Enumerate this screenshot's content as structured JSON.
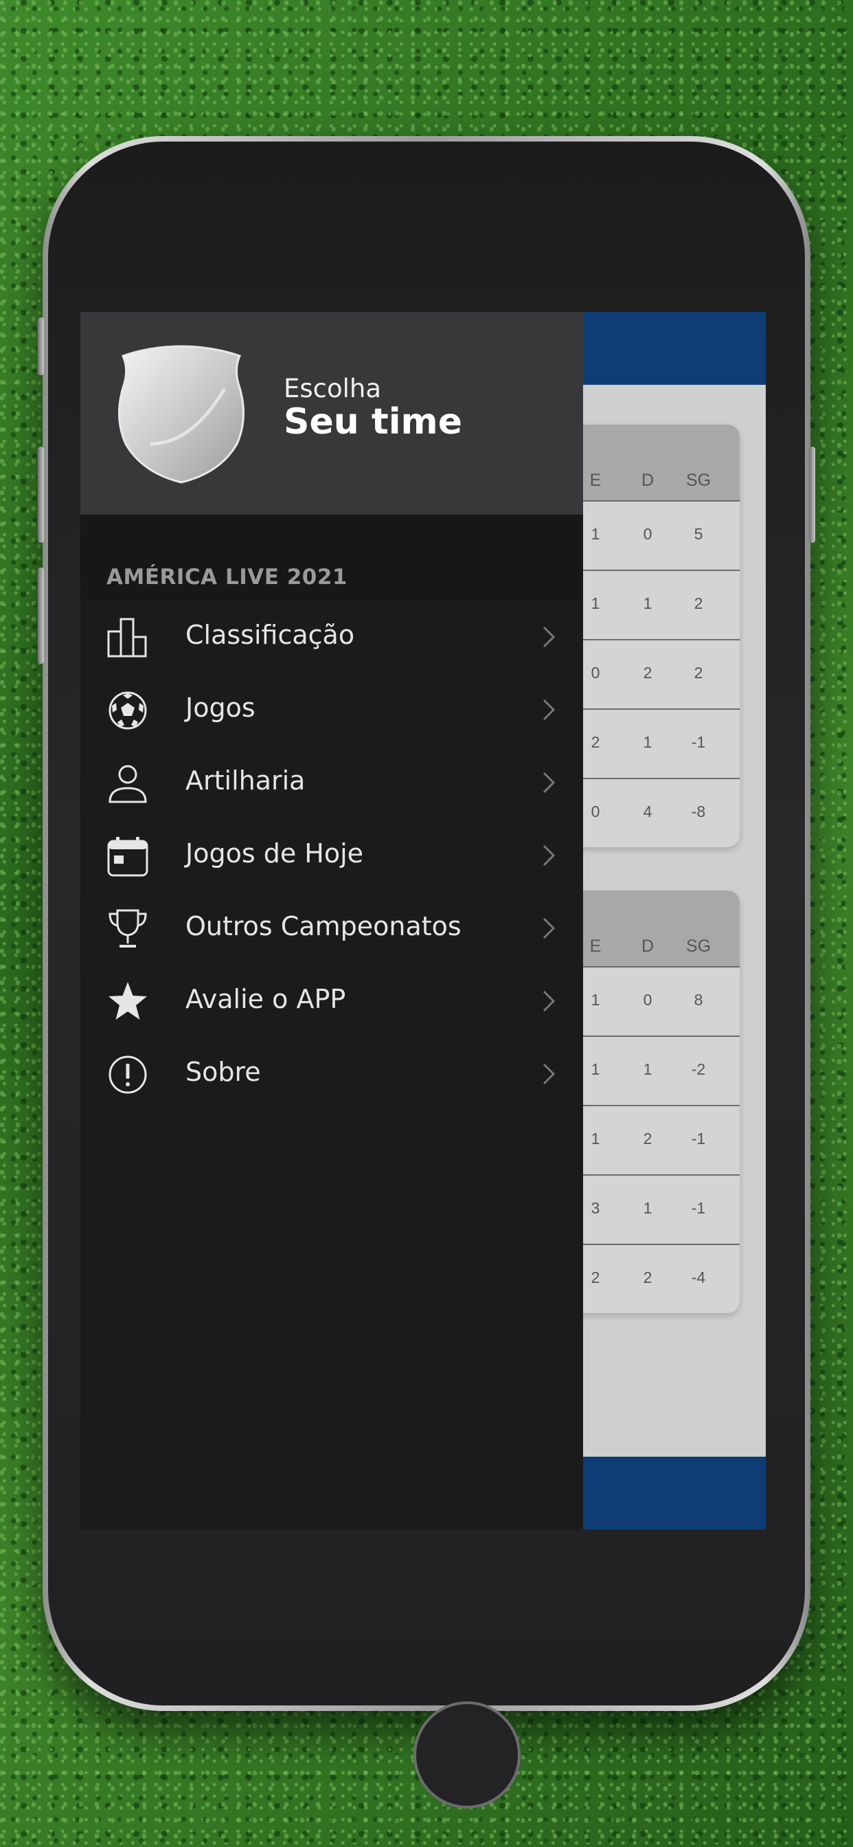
{
  "app": {
    "header": {
      "subtitle": "Escolha",
      "title": "Seu time"
    },
    "section_title": "AMÉRICA LIVE 2021",
    "menu": [
      {
        "label": "Classificação",
        "icon": "bar-chart-icon"
      },
      {
        "label": "Jogos",
        "icon": "soccer-ball-icon"
      },
      {
        "label": "Artilharia",
        "icon": "person-icon"
      },
      {
        "label": "Jogos de Hoje",
        "icon": "calendar-icon"
      },
      {
        "label": "Outros Campeonatos",
        "icon": "trophy-icon"
      },
      {
        "label": "Avalie o APP",
        "icon": "star-icon"
      },
      {
        "label": "Sobre",
        "icon": "info-circle-icon"
      }
    ]
  },
  "tables": [
    {
      "columns": [
        "E",
        "D",
        "SG"
      ],
      "rows": [
        [
          "1",
          "0",
          "5"
        ],
        [
          "1",
          "1",
          "2"
        ],
        [
          "0",
          "2",
          "2"
        ],
        [
          "2",
          "1",
          "-1"
        ],
        [
          "0",
          "4",
          "-8"
        ]
      ]
    },
    {
      "columns": [
        "E",
        "D",
        "SG"
      ],
      "rows": [
        [
          "1",
          "0",
          "8"
        ],
        [
          "1",
          "1",
          "-2"
        ],
        [
          "1",
          "2",
          "-1"
        ],
        [
          "3",
          "1",
          "-1"
        ],
        [
          "2",
          "2",
          "-4"
        ]
      ]
    }
  ],
  "colors": {
    "drawer_bg": "#1b1b1c",
    "header_bg": "#38383b",
    "app_bar": "#0e3c74",
    "table_header": "#a8a8a8"
  }
}
